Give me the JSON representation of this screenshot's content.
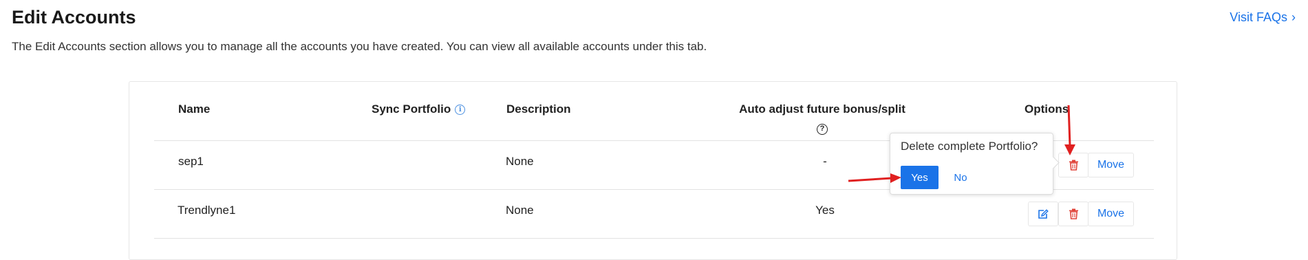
{
  "header": {
    "title": "Edit Accounts",
    "faq_label": "Visit FAQs",
    "faq_chevron": "›",
    "description": "The Edit Accounts section allows you to manage all the accounts you have created. You can view all available accounts under this tab."
  },
  "table": {
    "columns": {
      "name": "Name",
      "sync": "Sync Portfolio",
      "description": "Description",
      "auto_adjust": "Auto adjust future bonus/split",
      "options": "Options"
    },
    "rows": [
      {
        "name": "sep1",
        "description": "None",
        "auto_adjust": "-"
      },
      {
        "name": "Trendlyne1",
        "description": "None",
        "auto_adjust": "Yes"
      }
    ],
    "move_label": "Move"
  },
  "popover": {
    "question": "Delete complete Portfolio?",
    "yes_label": "Yes",
    "no_label": "No"
  },
  "icons": {
    "info": "info-icon",
    "help": "question-circle-icon",
    "delete": "trash-icon",
    "edit": "edit-icon"
  },
  "colors": {
    "accent": "#1a73e8",
    "delete": "#e0443a",
    "annotation_arrow": "#e02020"
  }
}
